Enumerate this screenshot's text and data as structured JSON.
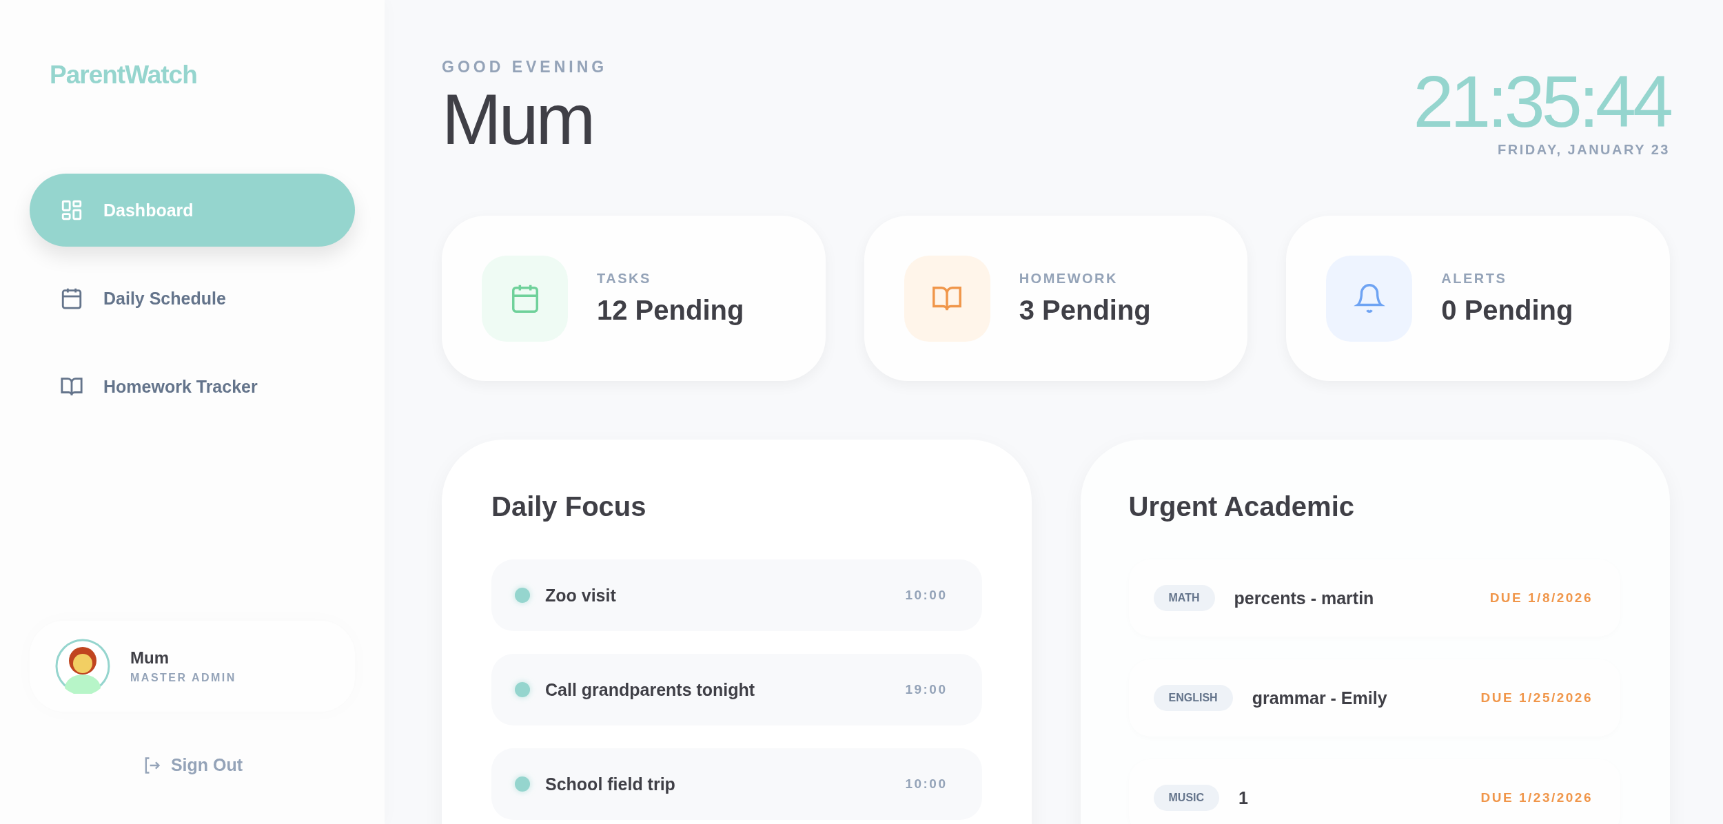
{
  "sidebar": {
    "logo": "ParentWatch",
    "nav": [
      {
        "label": "Dashboard",
        "kind": "grid",
        "selected": true
      },
      {
        "label": "Daily Schedule",
        "kind": "calendar",
        "selected": false
      },
      {
        "label": "Homework Tracker",
        "kind": "book",
        "selected": false
      }
    ],
    "profile": {
      "name": "Mum",
      "role": "MASTER ADMIN"
    },
    "sign_out": "Sign Out"
  },
  "header": {
    "greeting": "GOOD EVENING",
    "name": "Mum",
    "clock": "21:35:44",
    "date": "FRIDAY, JANUARY 23"
  },
  "stats": [
    {
      "kind": "tasks",
      "label": "TASKS",
      "value": "12 Pending"
    },
    {
      "kind": "homework",
      "label": "HOMEWORK",
      "value": "3 Pending"
    },
    {
      "kind": "alerts",
      "label": "ALERTS",
      "value": "0 Pending"
    }
  ],
  "daily_focus": {
    "title": "Daily Focus",
    "items": [
      {
        "text": "Zoo visit",
        "time": "10:00"
      },
      {
        "text": "Call grandparents tonight",
        "time": "19:00"
      },
      {
        "text": "School field trip",
        "time": "10:00"
      }
    ]
  },
  "urgent_academic": {
    "title": "Urgent Academic",
    "items": [
      {
        "subject": "MATH",
        "task": "percents - martin",
        "due": "DUE 1/8/2026"
      },
      {
        "subject": "ENGLISH",
        "task": "grammar - Emily",
        "due": "DUE 1/25/2026"
      },
      {
        "subject": "MUSIC",
        "task": "1",
        "due": "DUE 1/23/2026"
      }
    ]
  }
}
